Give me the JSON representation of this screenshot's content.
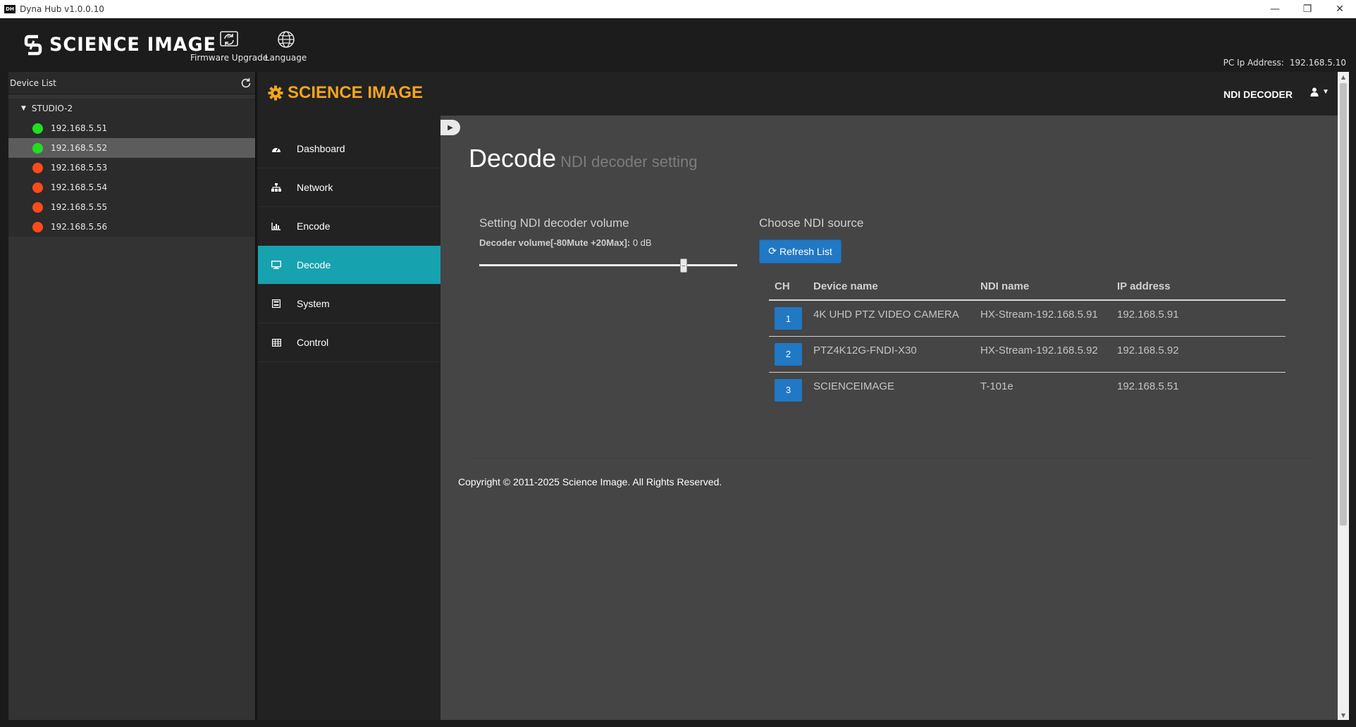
{
  "window": {
    "icon_text": "DH",
    "title": "Dyna Hub v1.0.0.10",
    "controls": {
      "minimize": "—",
      "restore": "❐",
      "close": "✕"
    }
  },
  "header": {
    "brand": "SCIENCE IMAGE",
    "brand_reg": "®",
    "buttons": [
      {
        "label": "Firmware Upgrade",
        "icon": "firmware-upgrade-icon"
      },
      {
        "label": "Language",
        "icon": "globe-icon"
      }
    ],
    "pc_ip_label": "PC Ip Address:",
    "pc_ip_value": "192.168.5.10"
  },
  "device_list": {
    "title": "Device List",
    "refresh_icon": "refresh-icon",
    "group": "STUDIO-2",
    "devices": [
      {
        "ip": "192.168.5.51",
        "status": "online",
        "color": "#22dd22"
      },
      {
        "ip": "192.168.5.52",
        "status": "online",
        "color": "#22dd22",
        "selected": true
      },
      {
        "ip": "192.168.5.53",
        "status": "offline",
        "color": "#ff4a1c"
      },
      {
        "ip": "192.168.5.54",
        "status": "offline",
        "color": "#ff4a1c"
      },
      {
        "ip": "192.168.5.55",
        "status": "offline",
        "color": "#ff4a1c"
      },
      {
        "ip": "192.168.5.56",
        "status": "offline",
        "color": "#ff4a1c"
      }
    ]
  },
  "web": {
    "brand": "SCIENCE IMAGE",
    "brand_color": "#f2a51c",
    "device_name": "NDI DECODER",
    "user_icon": "user-icon",
    "nav": [
      {
        "label": "Dashboard",
        "icon": "dashboard-icon"
      },
      {
        "label": "Network",
        "icon": "network-icon"
      },
      {
        "label": "Encode",
        "icon": "chart-icon"
      },
      {
        "label": "Decode",
        "icon": "monitor-icon",
        "active": true
      },
      {
        "label": "System",
        "icon": "system-icon"
      },
      {
        "label": "Control",
        "icon": "grid-icon"
      }
    ],
    "accent_color": "#17a2b0",
    "page_title": "Decode",
    "page_subtitle": "NDI decoder setting",
    "volume": {
      "title": "Setting NDI decoder volume",
      "label": "Decoder volume[-80Mute +20Max]:",
      "value_text": "0 dB",
      "value_db": 0,
      "min_db": -80,
      "max_db": 20
    },
    "source": {
      "title": "Choose NDI source",
      "refresh_label": "Refresh List",
      "columns": [
        "CH",
        "Device name",
        "NDI name",
        "IP address"
      ],
      "rows": [
        {
          "ch": "1",
          "device": "4K UHD PTZ VIDEO CAMERA",
          "ndi": "HX-Stream-192.168.5.91",
          "ip": "192.168.5.91"
        },
        {
          "ch": "2",
          "device": "PTZ4K12G-FNDI-X30",
          "ndi": "HX-Stream-192.168.5.92",
          "ip": "192.168.5.92"
        },
        {
          "ch": "3",
          "device": "SCIENCEIMAGE",
          "ndi": "T-101e",
          "ip": "192.168.5.51"
        }
      ]
    },
    "copyright": "Copyright © 2011-2025 Science Image. All Rights Reserved."
  }
}
